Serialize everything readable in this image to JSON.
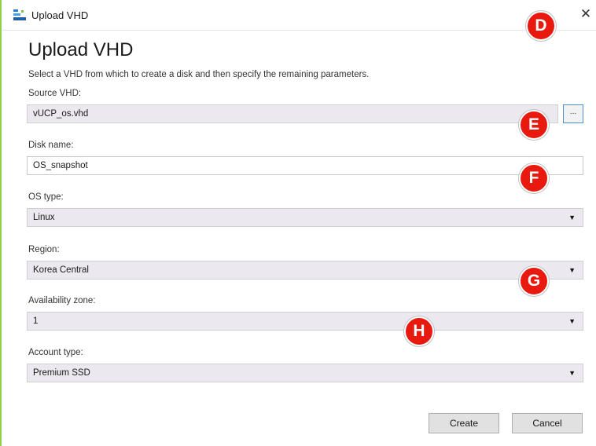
{
  "window": {
    "title": "Upload VHD",
    "close_glyph": "✕"
  },
  "dialog": {
    "heading": "Upload VHD",
    "description": "Select a VHD from which to create a disk and then specify the remaining parameters."
  },
  "source_vhd": {
    "label": "Source VHD:",
    "value": "vUCP_os.vhd",
    "browse_label": "..."
  },
  "disk_name": {
    "label": "Disk name:",
    "value": "OS_snapshot"
  },
  "os_type": {
    "label": "OS type:",
    "value": "Linux"
  },
  "region": {
    "label": "Region:",
    "value": "Korea Central"
  },
  "availability_zone": {
    "label": "Availability zone:",
    "value": "1"
  },
  "account_type": {
    "label": "Account type:",
    "value": "Premium SSD"
  },
  "buttons": {
    "create": "Create",
    "cancel": "Cancel"
  },
  "markers": {
    "d": "D",
    "e": "E",
    "f": "F",
    "g": "G",
    "h": "H"
  },
  "icons": {
    "app": "upload-vhd-icon",
    "dropdown": "caret-down-icon",
    "close": "close-icon"
  },
  "colors": {
    "marker": "#e8190f",
    "window_border": "#8fd14f",
    "browse_border": "#4a90d9"
  }
}
